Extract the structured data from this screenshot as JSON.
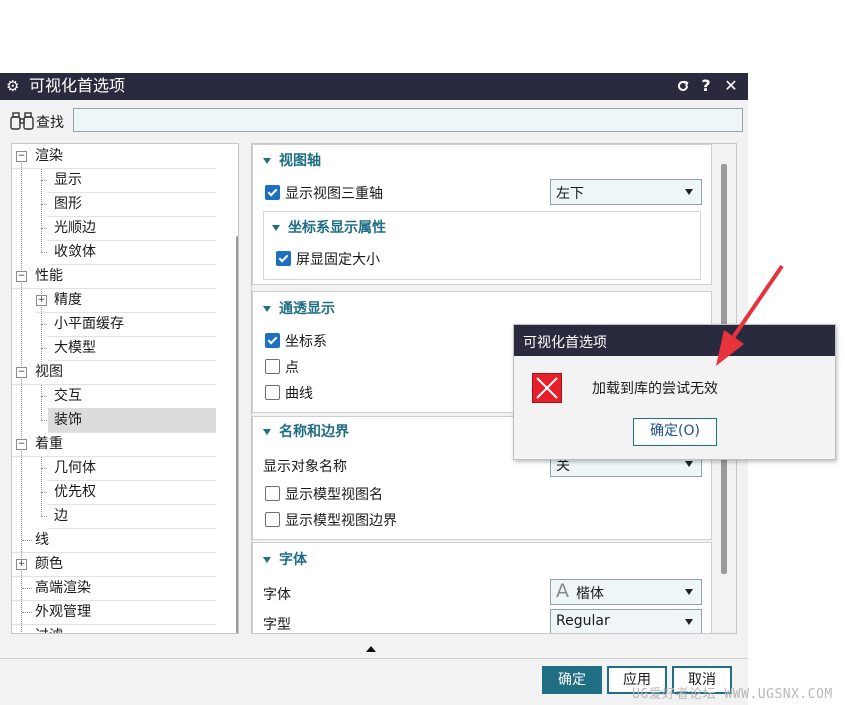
{
  "window": {
    "title": "可视化首选项",
    "controls": {
      "reset_icon": "reset-icon",
      "help": "?",
      "close": "✕"
    }
  },
  "search": {
    "label": "查找",
    "value": "",
    "icon": "binoculars-icon"
  },
  "tree": {
    "items": [
      {
        "label": "渲染",
        "level": 0,
        "toggle": "−"
      },
      {
        "label": "显示",
        "level": 1
      },
      {
        "label": "图形",
        "level": 1
      },
      {
        "label": "光顺边",
        "level": 1
      },
      {
        "label": "收敛体",
        "level": 1
      },
      {
        "label": "性能",
        "level": 0,
        "toggle": "−"
      },
      {
        "label": "精度",
        "level": 1,
        "toggle": "+"
      },
      {
        "label": "小平面缓存",
        "level": 1
      },
      {
        "label": "大模型",
        "level": 1
      },
      {
        "label": "视图",
        "level": 0,
        "toggle": "−"
      },
      {
        "label": "交互",
        "level": 1
      },
      {
        "label": "装饰",
        "level": 1,
        "selected": true
      },
      {
        "label": "着重",
        "level": 0,
        "toggle": "−"
      },
      {
        "label": "几何体",
        "level": 1
      },
      {
        "label": "优先权",
        "level": 1
      },
      {
        "label": "边",
        "level": 1
      },
      {
        "label": "线",
        "level": 0
      },
      {
        "label": "颜色",
        "level": 0,
        "toggle": "+"
      },
      {
        "label": "高端渲染",
        "level": 0
      },
      {
        "label": "外观管理",
        "level": 0
      },
      {
        "label": "过滤",
        "level": 0
      }
    ]
  },
  "sections": {
    "view_triad": {
      "title": "视图轴",
      "show_triad_label": "显示视图三重轴",
      "show_triad_checked": true,
      "position_value": "左下",
      "sub_title": "坐标系显示属性",
      "fixed_size_label": "屏显固定大小",
      "fixed_size_checked": true
    },
    "transparency": {
      "title": "通透显示",
      "csys_label": "坐标系",
      "csys_checked": true,
      "point_label": "点",
      "point_checked": false,
      "curve_label": "曲线",
      "curve_checked": false
    },
    "names_borders": {
      "title": "名称和边界",
      "show_name_label": "显示对象名称",
      "show_name_value": "关",
      "model_view_name_label": "显示模型视图名",
      "model_view_name_checked": false,
      "model_view_border_label": "显示模型视图边界",
      "model_view_border_checked": false
    },
    "font": {
      "title": "字体",
      "font_label": "字体",
      "font_icon": "A",
      "font_value": "楷体",
      "style_label": "字型",
      "style_value": "Regular"
    }
  },
  "buttons": {
    "ok": "确定",
    "apply": "应用",
    "cancel": "取消"
  },
  "message": {
    "title": "可视化首选项",
    "text": "加载到库的尝试无效",
    "ok": "确定(O)",
    "icon": "error-icon"
  },
  "colors": {
    "titlebar": "#2a2a3f",
    "accent": "#1f6e84",
    "error": "#e4202a",
    "annotation_arrow": "#e8323c"
  },
  "watermark": "UG爱好者论坛 WWW.UGSNX.COM"
}
